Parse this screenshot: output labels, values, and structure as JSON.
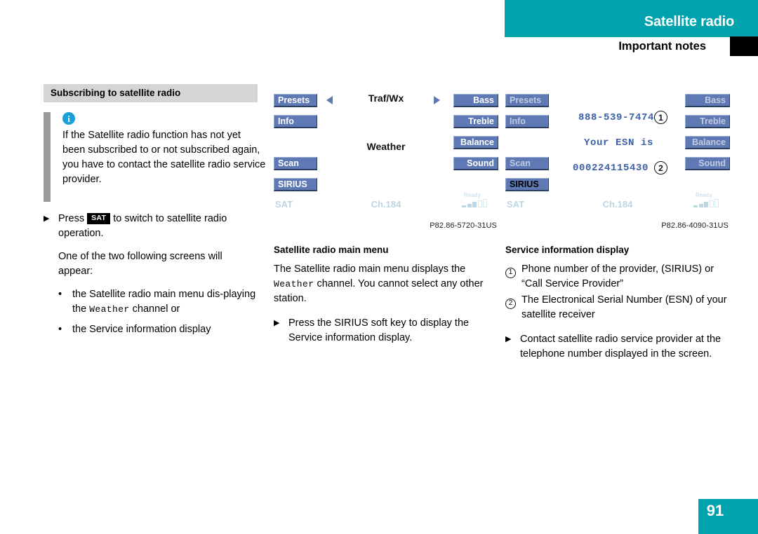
{
  "header": {
    "title": "Satellite radio",
    "subtitle": "Important notes"
  },
  "left_column": {
    "section_title": "Subscribing to satellite radio",
    "note": {
      "icon": "info-icon",
      "text": "If the Satellite radio function has not yet been subscribed to or not subscribed again, you have to contact the satellite radio service provider."
    },
    "step": {
      "arrow": "▶",
      "text_before": "Press",
      "key_label": "SAT",
      "text_after": "to switch to satellite radio operation."
    },
    "paragraph": "One of the two following screens will appear:",
    "bullets": [
      {
        "dot": "•",
        "text_before": "the Satellite radio main menu dis-playing the",
        "mono": "Weather",
        "text_after": "channel or"
      },
      {
        "dot": "•",
        "text_before": "the Service information display",
        "mono": "",
        "text_after": ""
      }
    ]
  },
  "middle_column": {
    "display": {
      "left_buttons": [
        "Presets",
        "Info",
        "Scan",
        "SIRIUS"
      ],
      "right_buttons": [
        "Bass",
        "Treble",
        "Balance",
        "Sound"
      ],
      "arrow_left": "left-triangle-icon",
      "arrow_right": "right-triangle-icon",
      "top_label": "Traf/Wx",
      "center_label": "Weather",
      "status_source": "SAT",
      "status_channel": "Ch.184",
      "signal_label": "Ready",
      "signal_bars": [
        "f",
        "f",
        "f",
        "e",
        "e"
      ]
    },
    "figure_caption": "P82.86-5720-31US",
    "sub_head": "Satellite radio main menu",
    "paragraph_before": "The Satellite radio main menu displays the",
    "paragraph_mono": "Weather",
    "paragraph_after": "channel. You cannot select any other station.",
    "step": {
      "arrow": "▶",
      "text": "Press the SIRIUS soft key to display the Service information display."
    }
  },
  "right_column": {
    "display": {
      "left_buttons": [
        "Presets",
        "Info",
        "Scan",
        "SIRIUS"
      ],
      "right_buttons": [
        "Bass",
        "Treble",
        "Balance",
        "Sound"
      ],
      "phone_number": "888-539-7474",
      "esn_label": "Your ESN is",
      "esn_value": "000224115430",
      "callout_1": "1",
      "callout_2": "2",
      "status_source": "SAT",
      "status_channel": "Ch.184",
      "signal_label": "Ready",
      "signal_bars": [
        "f",
        "f",
        "f",
        "e",
        "e"
      ]
    },
    "figure_caption": "P82.86-4090-31US",
    "sub_head": "Service information display",
    "items": [
      {
        "num": "1",
        "text": "Phone number of the provider, (SIRIUS) or “Call Service Provider”"
      },
      {
        "num": "2",
        "text": "The Electronical Serial Number (ESN) of your satellite receiver"
      }
    ],
    "step": {
      "arrow": "▶",
      "text": "Contact satellite radio service provider at the telephone number displayed in the screen."
    }
  },
  "footer": {
    "page_number": "91"
  },
  "colors": {
    "accent_teal": "#00a3ad",
    "button_blue": "#5f79b4",
    "display_text_blue": "#3d5fa8",
    "section_gray": "#d5d5d5"
  }
}
